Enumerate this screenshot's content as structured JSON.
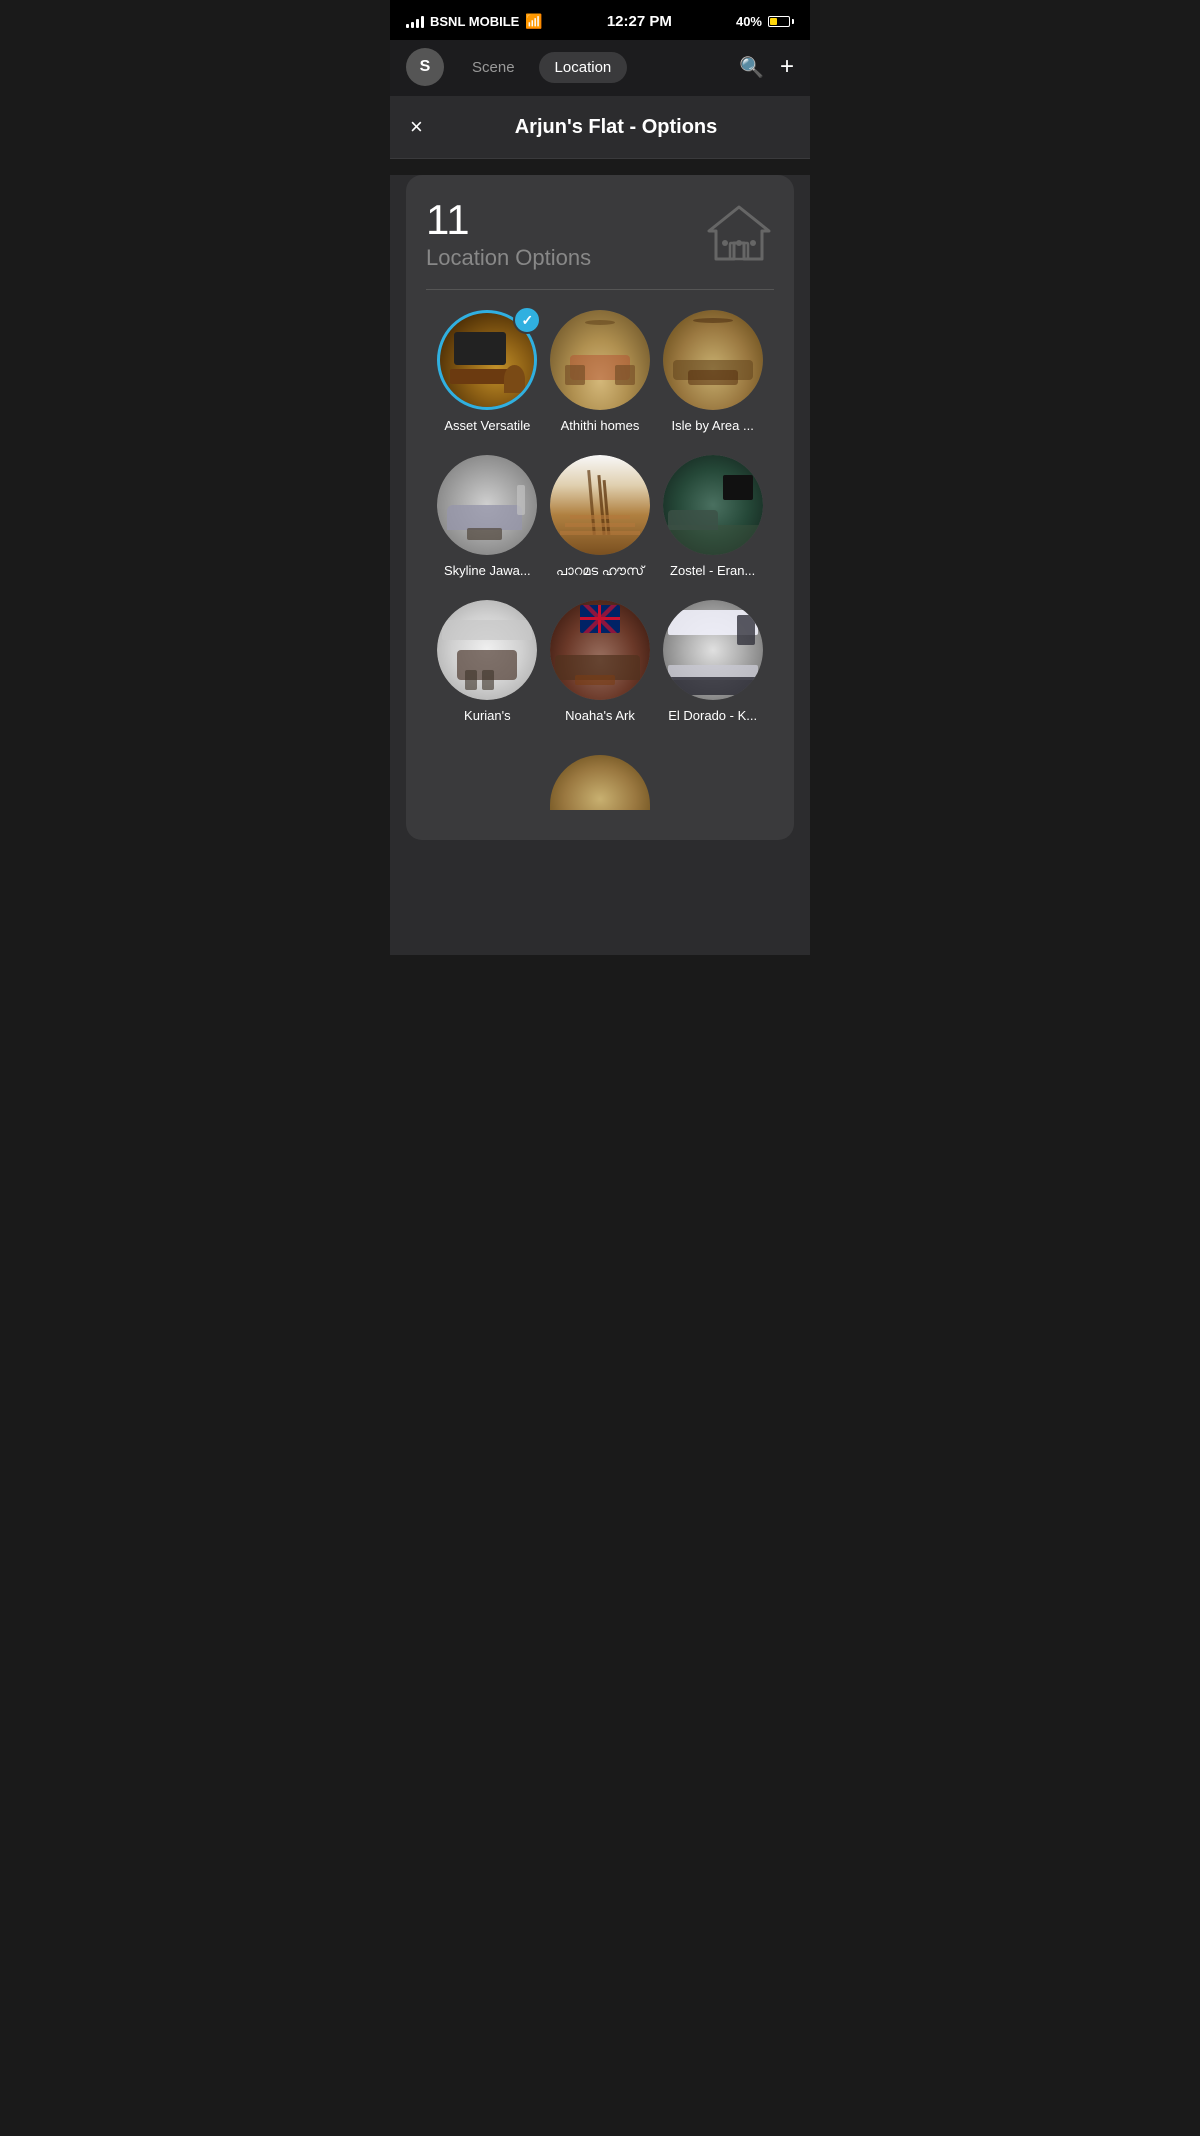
{
  "statusBar": {
    "carrier": "BSNL MOBILE",
    "time": "12:27 PM",
    "battery": "40%",
    "wifi": true
  },
  "navBar": {
    "avatar": "S",
    "tabs": [
      {
        "label": "Scene",
        "active": false
      },
      {
        "label": "Location",
        "active": true
      }
    ],
    "searchIcon": "🔍",
    "addIcon": "+"
  },
  "modal": {
    "title": "Arjun's Flat - Options",
    "closeLabel": "×"
  },
  "stats": {
    "count": "11",
    "label": "Location Options"
  },
  "locations": [
    {
      "name": "Asset Versatile",
      "selected": true,
      "roomClass": "room-living-warm"
    },
    {
      "name": "Athithi homes",
      "selected": false,
      "roomClass": "room-large-living"
    },
    {
      "name": "Isle by Area ...",
      "selected": false,
      "roomClass": "room-airy-living"
    },
    {
      "name": "Skyline Jawa...",
      "selected": false,
      "roomClass": "room-modern-living"
    },
    {
      "name": "പാറമട ഹൗസ്",
      "selected": false,
      "roomClass": "room-staircase"
    },
    {
      "name": "Zostel - Eran...",
      "selected": false,
      "roomClass": "room-dark-living"
    },
    {
      "name": "Kurian's",
      "selected": false,
      "roomClass": "room-white-kitchen"
    },
    {
      "name": "Noaha's Ark",
      "selected": false,
      "roomClass": "room-vintage"
    },
    {
      "name": "El Dorado - K...",
      "selected": false,
      "roomClass": "room-modern-kitchen"
    }
  ],
  "partialLocation": {
    "name": "",
    "roomClass": "room-airy-living"
  }
}
